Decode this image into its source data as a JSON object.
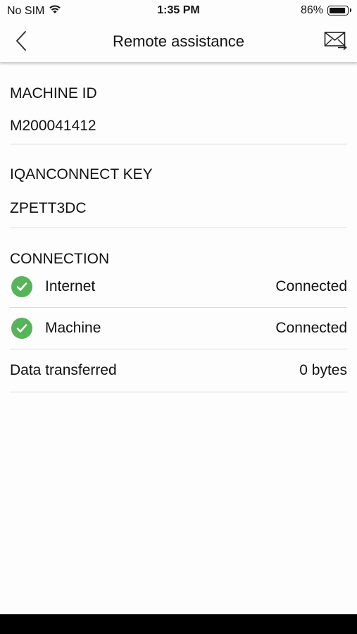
{
  "status_bar": {
    "carrier": "No SIM",
    "time": "1:35 PM",
    "battery_percent": "86%",
    "battery_level": 0.86
  },
  "nav": {
    "title": "Remote assistance",
    "back_icon": "chevron-left-icon",
    "action_icon": "mail-forward-icon"
  },
  "machine": {
    "label": "MACHINE ID",
    "value": "M200041412"
  },
  "key": {
    "label": "IQANCONNECT KEY",
    "value": "ZPETT3DC"
  },
  "connection": {
    "label": "CONNECTION",
    "rows": [
      {
        "label": "Internet",
        "value": "Connected",
        "icon": "check-circle-icon"
      },
      {
        "label": "Machine",
        "value": "Connected",
        "icon": "check-circle-icon"
      }
    ],
    "data_transferred": {
      "label": "Data transferred",
      "value": "0 bytes"
    }
  },
  "colors": {
    "check_green": "#57b45a",
    "divider": "#dadada"
  }
}
